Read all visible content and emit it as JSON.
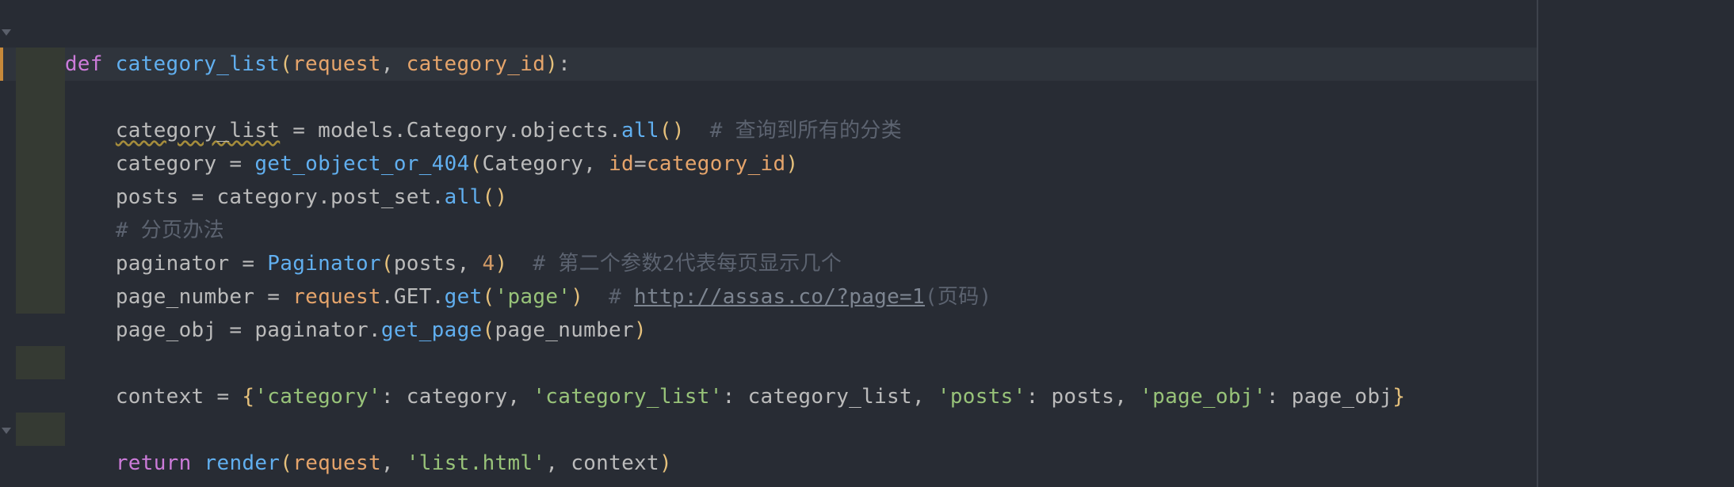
{
  "colors": {
    "background": "#282c34",
    "keyword": "#cc7bd9",
    "function": "#61afef",
    "parameter": "#e5a46b",
    "string": "#98c379",
    "number": "#d19a66",
    "comment": "#5c6370",
    "text": "#bbbbbb",
    "change_marker": "#c7893a"
  },
  "code": {
    "line1": {
      "kw_def": "def",
      "fn_name": "category_list",
      "p_open": "(",
      "param1": "request",
      "comma1": ", ",
      "param2": "category_id",
      "p_close": ")",
      "colon": ":"
    },
    "line3": {
      "var": "category_list",
      "rest": " = models.Category.objects.",
      "call": "all",
      "parens": "()",
      "comment": "  # 查询到所有的分类"
    },
    "line4": {
      "lhs": "category = ",
      "call": "get_object_or_404",
      "p_open": "(",
      "arg1": "Category, ",
      "kwarg": "id",
      "eq": "=",
      "kwval": "category_id",
      "p_close": ")"
    },
    "line5": {
      "lhs": "posts = category.post_set.",
      "call": "all",
      "parens": "()"
    },
    "line6": {
      "comment": "# 分页办法"
    },
    "line7": {
      "lhs": "paginator = ",
      "call": "Paginator",
      "p_open": "(",
      "arg1": "posts, ",
      "num": "4",
      "p_close": ")",
      "comment": "  # 第二个参数2代表每页显示几个"
    },
    "line8": {
      "lhs": "page_number = ",
      "obj": "request",
      "mid": ".GET.",
      "call": "get",
      "p_open": "(",
      "str": "'page'",
      "p_close": ")",
      "comment_prefix": "  # ",
      "url": "http://assas.co/?page=1",
      "comment_suffix": "(页码)"
    },
    "line9": {
      "lhs": "page_obj = paginator.",
      "call": "get_page",
      "p_open": "(",
      "arg": "page_number",
      "p_close": ")"
    },
    "line11": {
      "lhs": "context = ",
      "b_open": "{",
      "k1": "'category'",
      "v1": ": category, ",
      "k2": "'category_list'",
      "v2": ": category_list, ",
      "k3": "'posts'",
      "v3": ": posts, ",
      "k4": "'page_obj'",
      "v4": ": page_obj",
      "b_close": "}"
    },
    "line13": {
      "kw": "return",
      "sp": " ",
      "call": "render",
      "p_open": "(",
      "arg1": "request",
      "comma1": ", ",
      "str": "'list.html'",
      "rest": ", context",
      "p_close": ")"
    }
  }
}
